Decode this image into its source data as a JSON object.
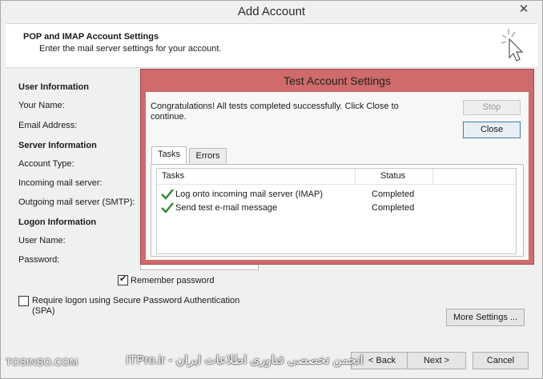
{
  "window": {
    "title": "Add Account",
    "close_glyph": "✕"
  },
  "header": {
    "title": "POP and IMAP Account Settings",
    "subtitle": "Enter the mail server settings for your account."
  },
  "form": {
    "user_info_heading": "User Information",
    "your_name_label": "Your Name:",
    "email_label": "Email Address:",
    "server_info_heading": "Server Information",
    "account_type_label": "Account Type:",
    "incoming_label": "Incoming mail server:",
    "outgoing_label": "Outgoing mail server (SMTP):",
    "logon_heading": "Logon Information",
    "username_label": "User Name:",
    "password_label": "Password:",
    "remember_password_label": "Remember password",
    "remember_password_checked": true,
    "spa_label_line1": "Require logon using Secure Password Authentication",
    "spa_label_line2": "(SPA)",
    "spa_checked": false,
    "more_settings_label": "More Settings ..."
  },
  "footer": {
    "back_label": "< Back",
    "next_label": "Next >",
    "cancel_label": "Cancel"
  },
  "test_dialog": {
    "title": "Test Account Settings",
    "message_line1": "Congratulations! All tests completed successfully. Click Close to",
    "message_line2": "continue.",
    "stop_label": "Stop",
    "close_label": "Close",
    "tabs": [
      {
        "label": "Tasks",
        "active": true
      },
      {
        "label": "Errors",
        "active": false
      }
    ],
    "columns": {
      "tasks": "Tasks",
      "status": "Status"
    },
    "rows": [
      {
        "task": "Log onto incoming mail server (IMAP)",
        "status": "Completed",
        "icon": "check-icon"
      },
      {
        "task": "Send test e-mail message",
        "status": "Completed",
        "icon": "check-icon"
      }
    ],
    "accent_color": "#cf6b6b"
  },
  "watermark": {
    "left_text": "TOSINSO.COM",
    "right_text": "انجمن تخصصی فناوری اطلاعات ایران - ITPro.ir"
  }
}
